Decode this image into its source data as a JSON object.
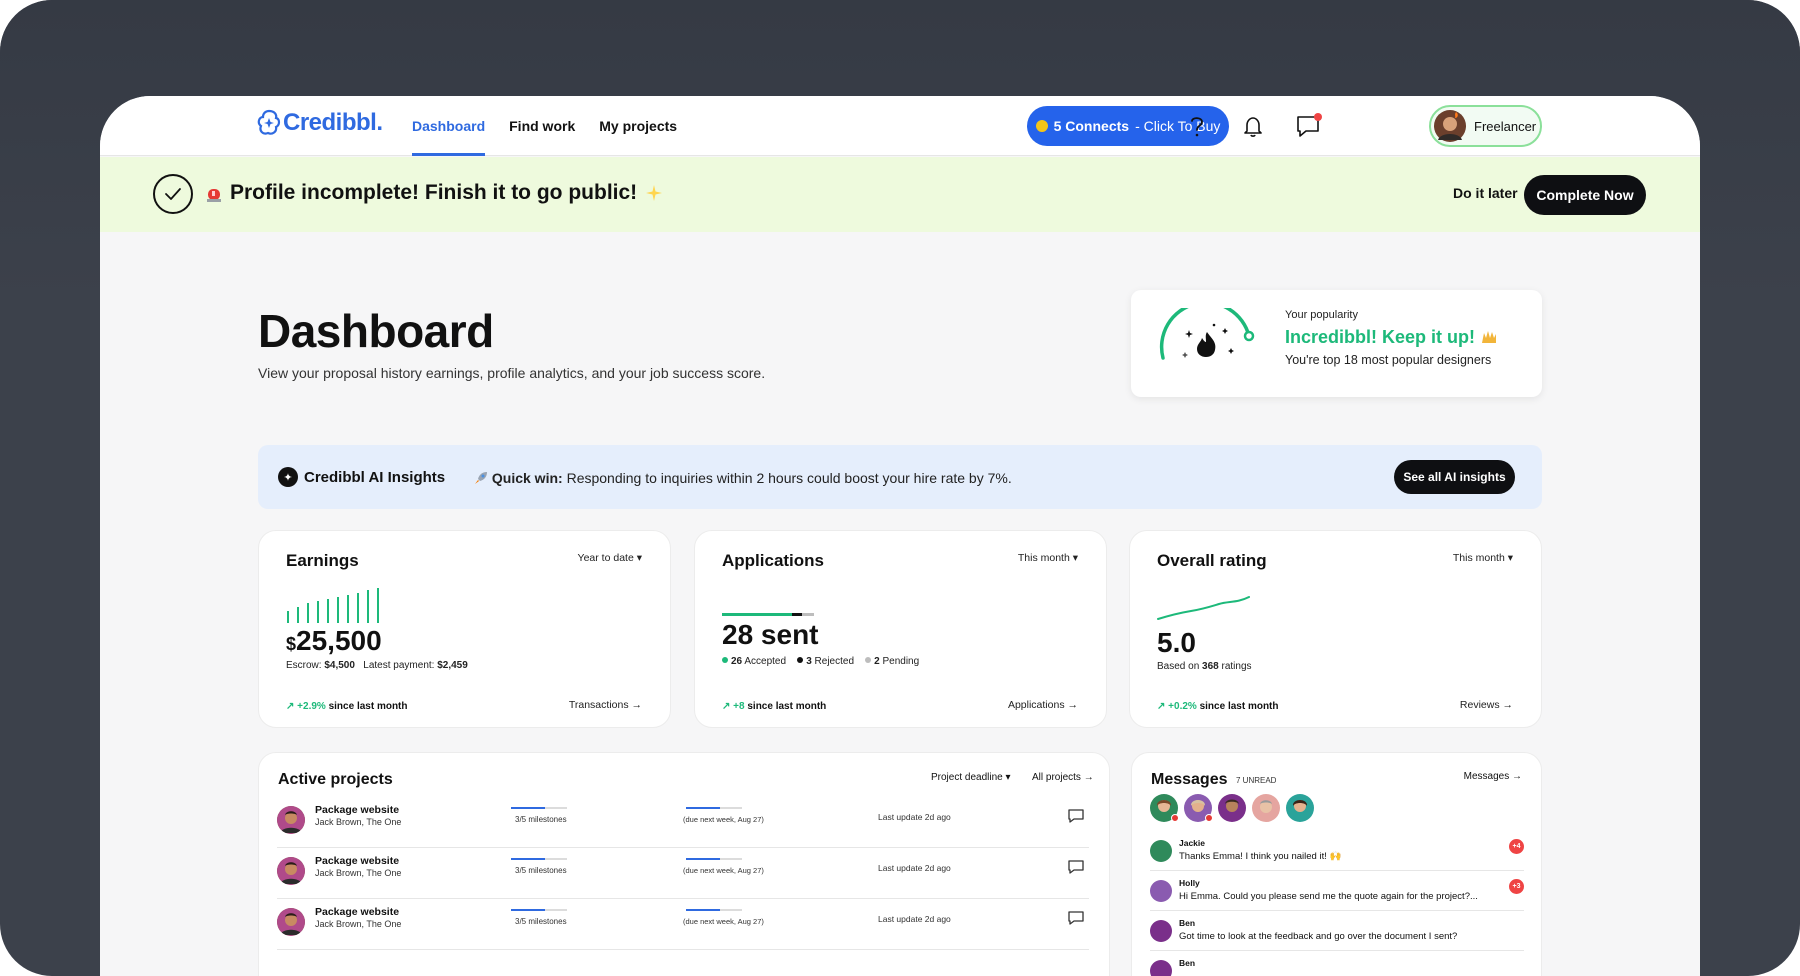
{
  "header": {
    "logo_text": "Credibbl.",
    "nav": [
      {
        "label": "Dashboard",
        "active": true
      },
      {
        "label": "Find work",
        "active": false
      },
      {
        "label": "My projects",
        "active": false
      }
    ],
    "connects_count": "5 Connects",
    "connects_cta": "- Click To Buy",
    "user_role": "Freelancer",
    "icons": [
      "help-icon",
      "bell-icon",
      "chat-icon"
    ]
  },
  "banner": {
    "text": "Profile incomplete! Finish it to go public!",
    "later_label": "Do it later",
    "complete_label": "Complete Now"
  },
  "page": {
    "title": "Dashboard",
    "subtitle": "View your proposal history earnings, profile analytics, and your job success score."
  },
  "popularity": {
    "label": "Your popularity",
    "title": "Incredibbl! Keep it up!",
    "subtitle": "You're top 18 most popular designers"
  },
  "insights": {
    "title": "Credibbl AI Insights",
    "lead": "Quick win:",
    "text": "Responding to inquiries within 2 hours could boost your hire rate by 7%.",
    "button": "See all AI insights"
  },
  "earnings": {
    "title": "Earnings",
    "filter": "Year to date",
    "currency": "$",
    "amount": "25,500",
    "escrow_label": "Escrow:",
    "escrow_value": "$4,500",
    "latest_label": "Latest payment:",
    "latest_value": "$2,459",
    "trend_value": "+2.9%",
    "trend_text": "since last month",
    "link": "Transactions"
  },
  "applications": {
    "title": "Applications",
    "filter": "This month",
    "big": "28 sent",
    "accepted": "26",
    "accepted_label": "Accepted",
    "rejected": "3",
    "rejected_label": "Rejected",
    "pending": "2",
    "pending_label": "Pending",
    "trend_value": "+8",
    "trend_text": "since last month",
    "link": "Applications"
  },
  "rating": {
    "title": "Overall rating",
    "filter": "This month",
    "value": "5.0",
    "based_label": "Based on",
    "based_count": "368",
    "based_suffix": "ratings",
    "trend_value": "+0.2%",
    "trend_text": "since last month",
    "link": "Reviews"
  },
  "projects": {
    "title": "Active projects",
    "sort": "Project deadline",
    "all": "All projects",
    "rows": [
      {
        "name": "Package website",
        "client": "Jack Brown, The One",
        "milestones": "3/5 milestones",
        "milestone_fraction": 0.6,
        "due": "(due next week, Aug 27)",
        "due_fraction": 0.6,
        "updated": "Last update 2d ago"
      },
      {
        "name": "Package website",
        "client": "Jack Brown, The One",
        "milestones": "3/5 milestones",
        "milestone_fraction": 0.6,
        "due": "(due next week, Aug 27)",
        "due_fraction": 0.6,
        "updated": "Last update 2d ago"
      },
      {
        "name": "Package website",
        "client": "Jack Brown, The One",
        "milestones": "3/5 milestones",
        "milestone_fraction": 0.6,
        "due": "(due next week, Aug 27)",
        "due_fraction": 0.6,
        "updated": "Last update 2d ago"
      }
    ]
  },
  "messages": {
    "title": "Messages",
    "unread": "7 UNREAD",
    "link": "Messages",
    "rows": [
      {
        "name": "Jackie",
        "text": "Thanks Emma! I think you nailed it! 🙌",
        "badge": "+4"
      },
      {
        "name": "Holly",
        "text": "Hi Emma. Could you please send me the quote again for the project?...",
        "badge": "+3"
      },
      {
        "name": "Ben",
        "text": "Got time to look at the feedback and go over the document I sent?",
        "badge": ""
      },
      {
        "name": "Ben",
        "text": "",
        "badge": ""
      }
    ]
  },
  "colors": {
    "brand": "#2f6ae0",
    "success": "#1db97a",
    "banner_bg": "#eefadd",
    "insights_bg": "#e5eefc"
  }
}
